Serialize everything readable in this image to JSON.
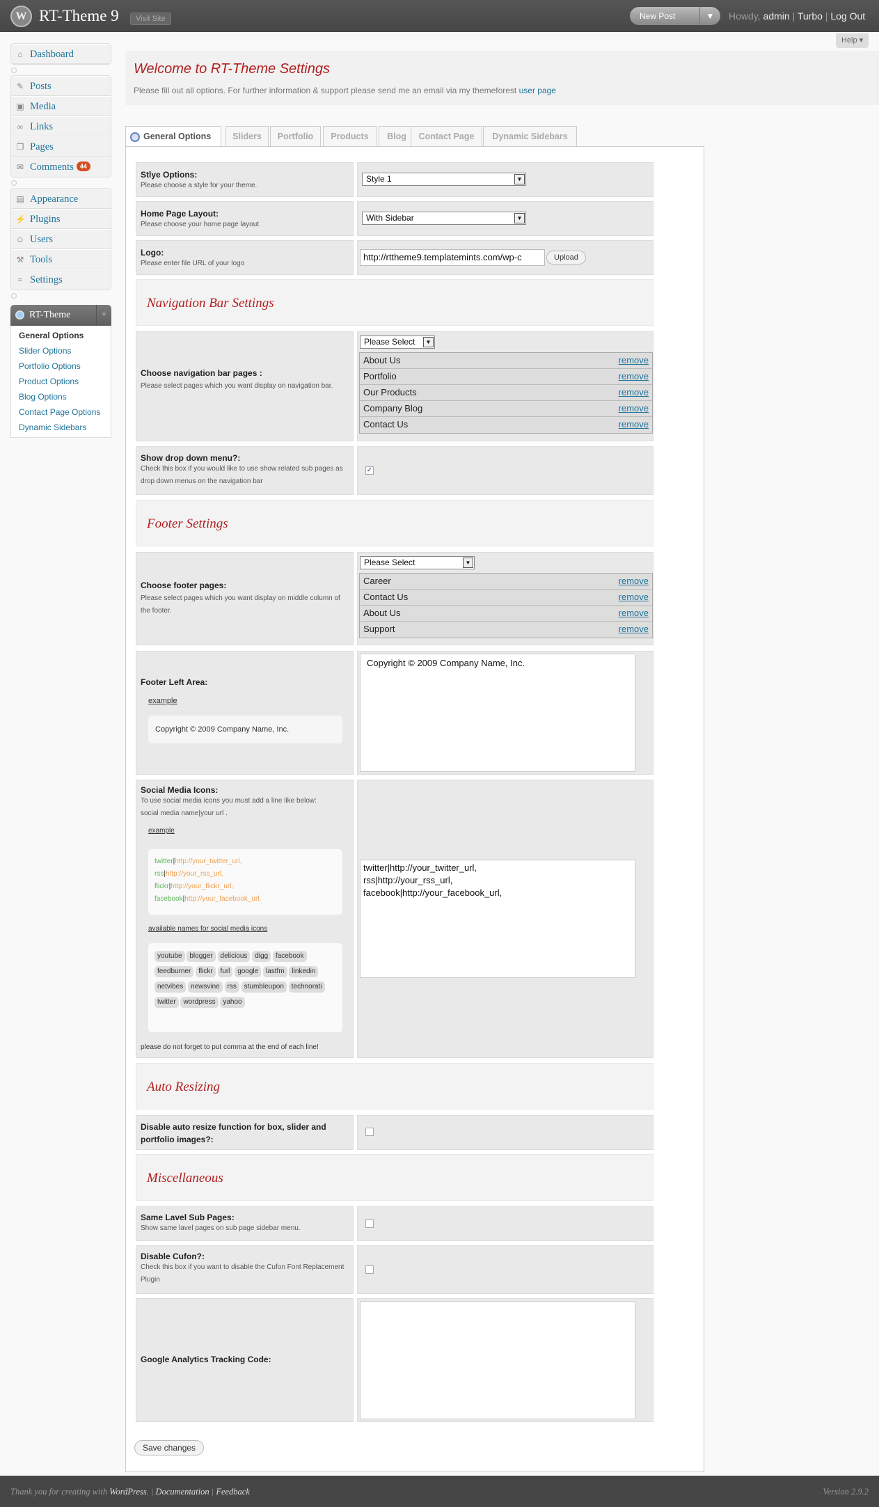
{
  "header": {
    "site_title": "RT-Theme 9",
    "visit_site": "Visit Site",
    "new_post": "New Post",
    "howdy": "Howdy,",
    "user": "admin",
    "turbo": "Turbo",
    "logout": "Log Out",
    "help": "Help"
  },
  "menu": {
    "dashboard": "Dashboard",
    "posts": "Posts",
    "media": "Media",
    "links": "Links",
    "pages": "Pages",
    "comments": "Comments",
    "comments_count": "44",
    "appearance": "Appearance",
    "plugins": "Plugins",
    "users": "Users",
    "tools": "Tools",
    "settings": "Settings",
    "rt_theme": "RT-Theme",
    "sub": [
      "General Options",
      "Slider Options",
      "Portfolio Options",
      "Product Options",
      "Blog Options",
      "Contact Page Options",
      "Dynamic Sidebars"
    ]
  },
  "welcome": {
    "title": "Welcome to RT-Theme Settings",
    "text": "Please fill out all options. For further information & support please send me an email via my themeforest ",
    "link": "user page"
  },
  "tabs": [
    "General Options",
    "Sliders",
    "Portfolio",
    "Products",
    "Blog",
    "Contact Page",
    "Dynamic Sidebars"
  ],
  "style": {
    "title": "Stlye Options:",
    "desc": "Please choose a style for your theme.",
    "value": "Style 1"
  },
  "layout": {
    "title": "Home Page Layout:",
    "desc": "Please choose your home page layout",
    "value": "With Sidebar"
  },
  "logo": {
    "title": "Logo:",
    "desc": "Please enter file URL of your logo",
    "value": "http://rttheme9.templatemints.com/wp-c",
    "upload": "Upload"
  },
  "sections": {
    "nav": "Navigation Bar Settings",
    "footer": "Footer Settings",
    "auto": "Auto Resizing",
    "misc": "Miscellaneous"
  },
  "navpages": {
    "title": "Choose navigation bar pages :",
    "desc": "Please select pages which you want display on navigation bar.",
    "select": "Please Select",
    "items": [
      "About Us",
      "Portfolio",
      "Our Products",
      "Company Blog",
      "Contact Us"
    ],
    "remove": "remove"
  },
  "dropdown": {
    "title": "Show drop down menu?:",
    "desc": "Check this box if you would like to use show related sub pages as drop down menus on the navigation bar",
    "check": "✓"
  },
  "footerpages": {
    "title": "Choose footer pages:",
    "desc": "Please select pages which you want display on middle column of the footer.",
    "select": "Please Select",
    "items": [
      "Career",
      "Contact Us",
      "About Us",
      "Support"
    ]
  },
  "footerleft": {
    "title": "Footer Left Area:",
    "example": "example",
    "example_text": "Copyright © 2009 Company Name, Inc.",
    "value": "Copyright © 2009 Company Name, Inc."
  },
  "social": {
    "title": "Social Media Icons:",
    "desc1": "To use social media icons you must add a line like below:",
    "desc2": "social media name|your url .",
    "example": "example",
    "ex": [
      {
        "n": "twitter",
        "u": "http://your_twitter_url,"
      },
      {
        "n": "rss",
        "u": "http://your_rss_url,"
      },
      {
        "n": "flickr",
        "u": "http://your_flickr_url,"
      },
      {
        "n": "facebook",
        "u": "http://your_facebook_url,"
      }
    ],
    "avail": "available names for social media icons",
    "names": [
      "youtube",
      "blogger",
      "delicious",
      "digg",
      "facebook",
      "feedburner",
      "flickr",
      "furl",
      "google",
      "lastfm",
      "linkedin",
      "netvibes",
      "newsvine",
      "rss",
      "stumbleupon",
      "technorati",
      "twitter",
      "wordpress",
      "yahoo"
    ],
    "note": "please do not forget to put comma at the end of each line!",
    "value": "twitter|http://your_twitter_url,\nrss|http://your_rss_url,\nfacebook|http://your_facebook_url,"
  },
  "autoresize": {
    "title": "Disable auto resize function for box, slider and portfolio images?:"
  },
  "samelevel": {
    "title": "Same Lavel Sub Pages:",
    "desc": "Show same lavel pages on sub page sidebar menu."
  },
  "cufon": {
    "title": "Disable Cufon?:",
    "desc": "Check this box if you want to disable the Cufon Font Replacement Plugin"
  },
  "analytics": {
    "title": "Google Analytics Tracking Code:"
  },
  "save": "Save changes",
  "footer": {
    "thanks": "Thank you for creating with ",
    "wp": "WordPress",
    "docs": "Documentation",
    "feedback": "Feedback",
    "version": "Version 2.9.2"
  },
  "colors": {
    "accent_red": "#b21e1e",
    "link": "#21759b",
    "header": "#464646"
  }
}
